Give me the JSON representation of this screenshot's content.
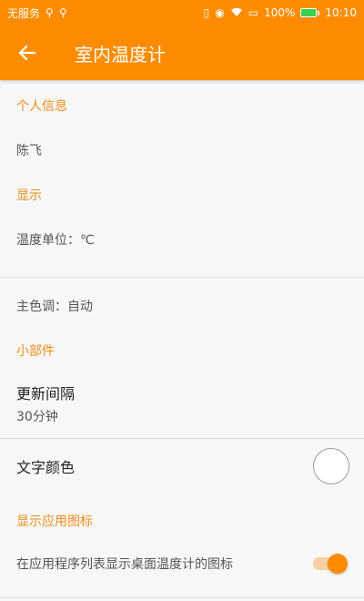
{
  "status_bar": {
    "carrier": "无服务",
    "battery_pct": "100%",
    "time": "10:10"
  },
  "app_bar": {
    "title": "室内温度计"
  },
  "sections": {
    "personal": {
      "title": "个人信息",
      "name": "陈飞"
    },
    "display": {
      "title": "显示",
      "unit": "温度单位：℃",
      "theme": "主色调：自动"
    },
    "widget": {
      "title": "小部件",
      "interval_title": "更新间隔",
      "interval_value": "30分钟",
      "text_color_title": "文字颜色"
    },
    "app_icon": {
      "title": "显示应用图标",
      "toggle_label": "在应用程序列表显示桌面温度计的图标",
      "toggle_on": true
    }
  },
  "colors": {
    "accent": "#ff8c00",
    "section_title": "#f08c1a"
  },
  "icons": {
    "back": "arrow-left-icon"
  }
}
